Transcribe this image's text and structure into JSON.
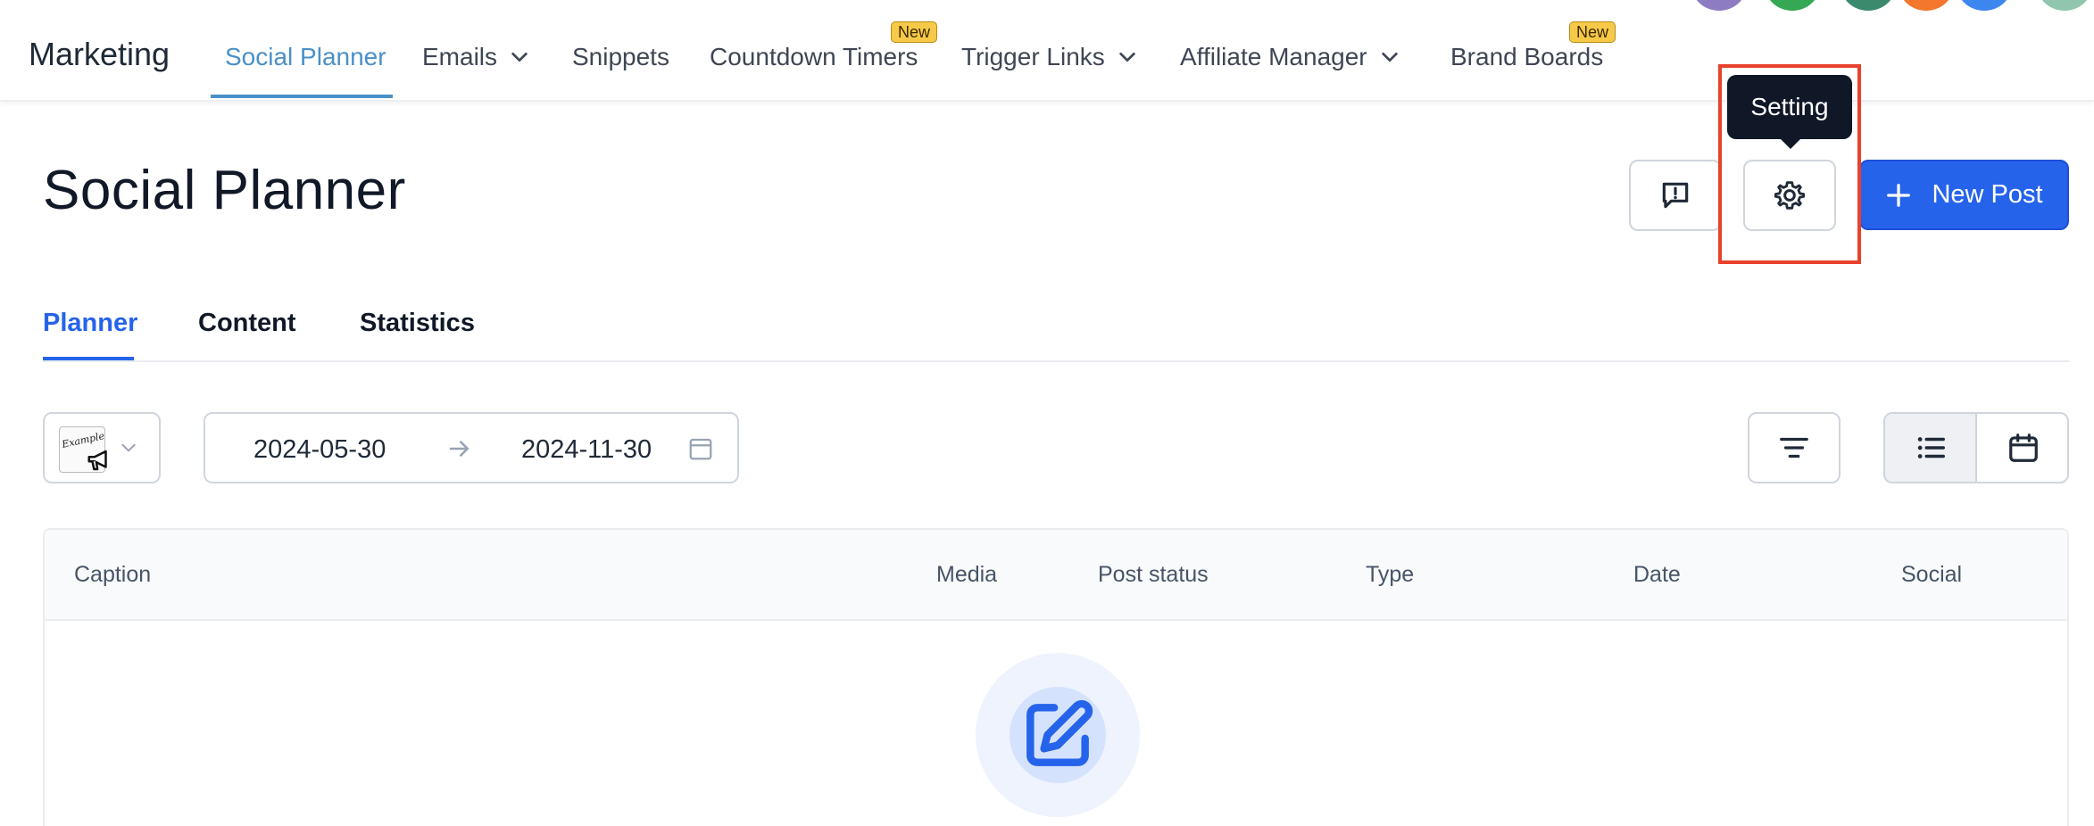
{
  "nav": {
    "brand": "Marketing",
    "items": [
      {
        "label": "Social Planner"
      },
      {
        "label": "Emails"
      },
      {
        "label": "Snippets"
      },
      {
        "label": "Countdown Timers",
        "badge": "New"
      },
      {
        "label": "Trigger Links"
      },
      {
        "label": "Affiliate Manager"
      },
      {
        "label": "Brand Boards",
        "badge": "New"
      }
    ]
  },
  "page": {
    "title": "Social Planner",
    "tooltip": "Setting",
    "new_post_label": "New Post"
  },
  "tabs": [
    {
      "label": "Planner"
    },
    {
      "label": "Content"
    },
    {
      "label": "Statistics"
    }
  ],
  "filters": {
    "account_thumb_text": "Example",
    "date_start": "2024-05-30",
    "date_end": "2024-11-30"
  },
  "table": {
    "columns": [
      "Caption",
      "Media",
      "Post status",
      "Type",
      "Date",
      "Social"
    ]
  },
  "colors": {
    "accent": "#2563eb",
    "nav_active": "#4a90c8",
    "highlight": "#e8412c",
    "badge": "#f7c948",
    "avatars": [
      "#8e7cc3",
      "#34a853",
      "#3b8a6e",
      "#f4772e",
      "#3d86f0",
      "#8fc6ad"
    ]
  },
  "icons": [
    "chevron-down-icon",
    "feedback-icon",
    "gear-icon",
    "plus-icon",
    "megaphone-icon",
    "chevron-down-icon",
    "arrow-right-icon",
    "calendar-icon",
    "filter-icon",
    "list-icon",
    "calendar-icon",
    "edit-icon"
  ]
}
